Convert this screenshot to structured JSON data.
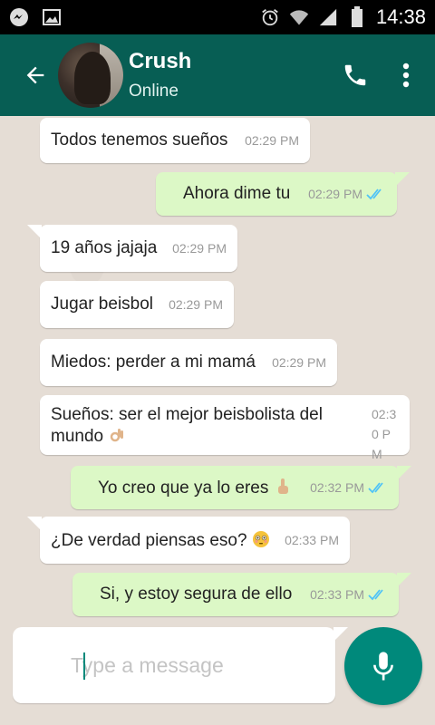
{
  "status_bar": {
    "time": "14:38",
    "icons": [
      "messenger-icon",
      "image-icon",
      "alarm-icon",
      "wifi-icon",
      "signal-icon",
      "battery-icon"
    ]
  },
  "header": {
    "contact_name": "Crush",
    "contact_status": "Online",
    "icons": [
      "back-arrow-icon",
      "phone-icon",
      "more-vert-icon"
    ]
  },
  "colors": {
    "header": "#075e54",
    "incoming_bubble": "#ffffff",
    "outgoing_bubble": "#dcf8c6",
    "accent": "#00897b",
    "read_ticks": "#4fc3f7"
  },
  "messages": [
    {
      "direction": "in",
      "text": "Todos tenemos sueños",
      "time": "02:29 PM"
    },
    {
      "direction": "out",
      "text": "Ahora dime tu",
      "time": "02:29 PM",
      "status": "read"
    },
    {
      "direction": "in",
      "text": "19 años jajaja",
      "time": "02:29 PM"
    },
    {
      "direction": "in",
      "text": "Jugar beisbol",
      "time": "02:29 PM"
    },
    {
      "direction": "in",
      "text": "Miedos: perder a mi mamá",
      "time": "02:29 PM"
    },
    {
      "direction": "in",
      "text": "Sueños: ser el mejor beisbolista del mundo",
      "time": "02:30 PM",
      "emoji": "ok-hand"
    },
    {
      "direction": "out",
      "text": "Yo creo que ya lo eres",
      "time": "02:32 PM",
      "status": "read",
      "emoji": "pointing-up"
    },
    {
      "direction": "in",
      "text": "¿De verdad piensas eso?",
      "time": "02:33 PM",
      "emoji": "flushed-face"
    },
    {
      "direction": "out",
      "text": "Si, y estoy segura de ello",
      "time": "02:33 PM",
      "status": "read"
    }
  ],
  "composer": {
    "placeholder": "Type a message",
    "value": "",
    "icons": [
      "mic-icon"
    ]
  }
}
